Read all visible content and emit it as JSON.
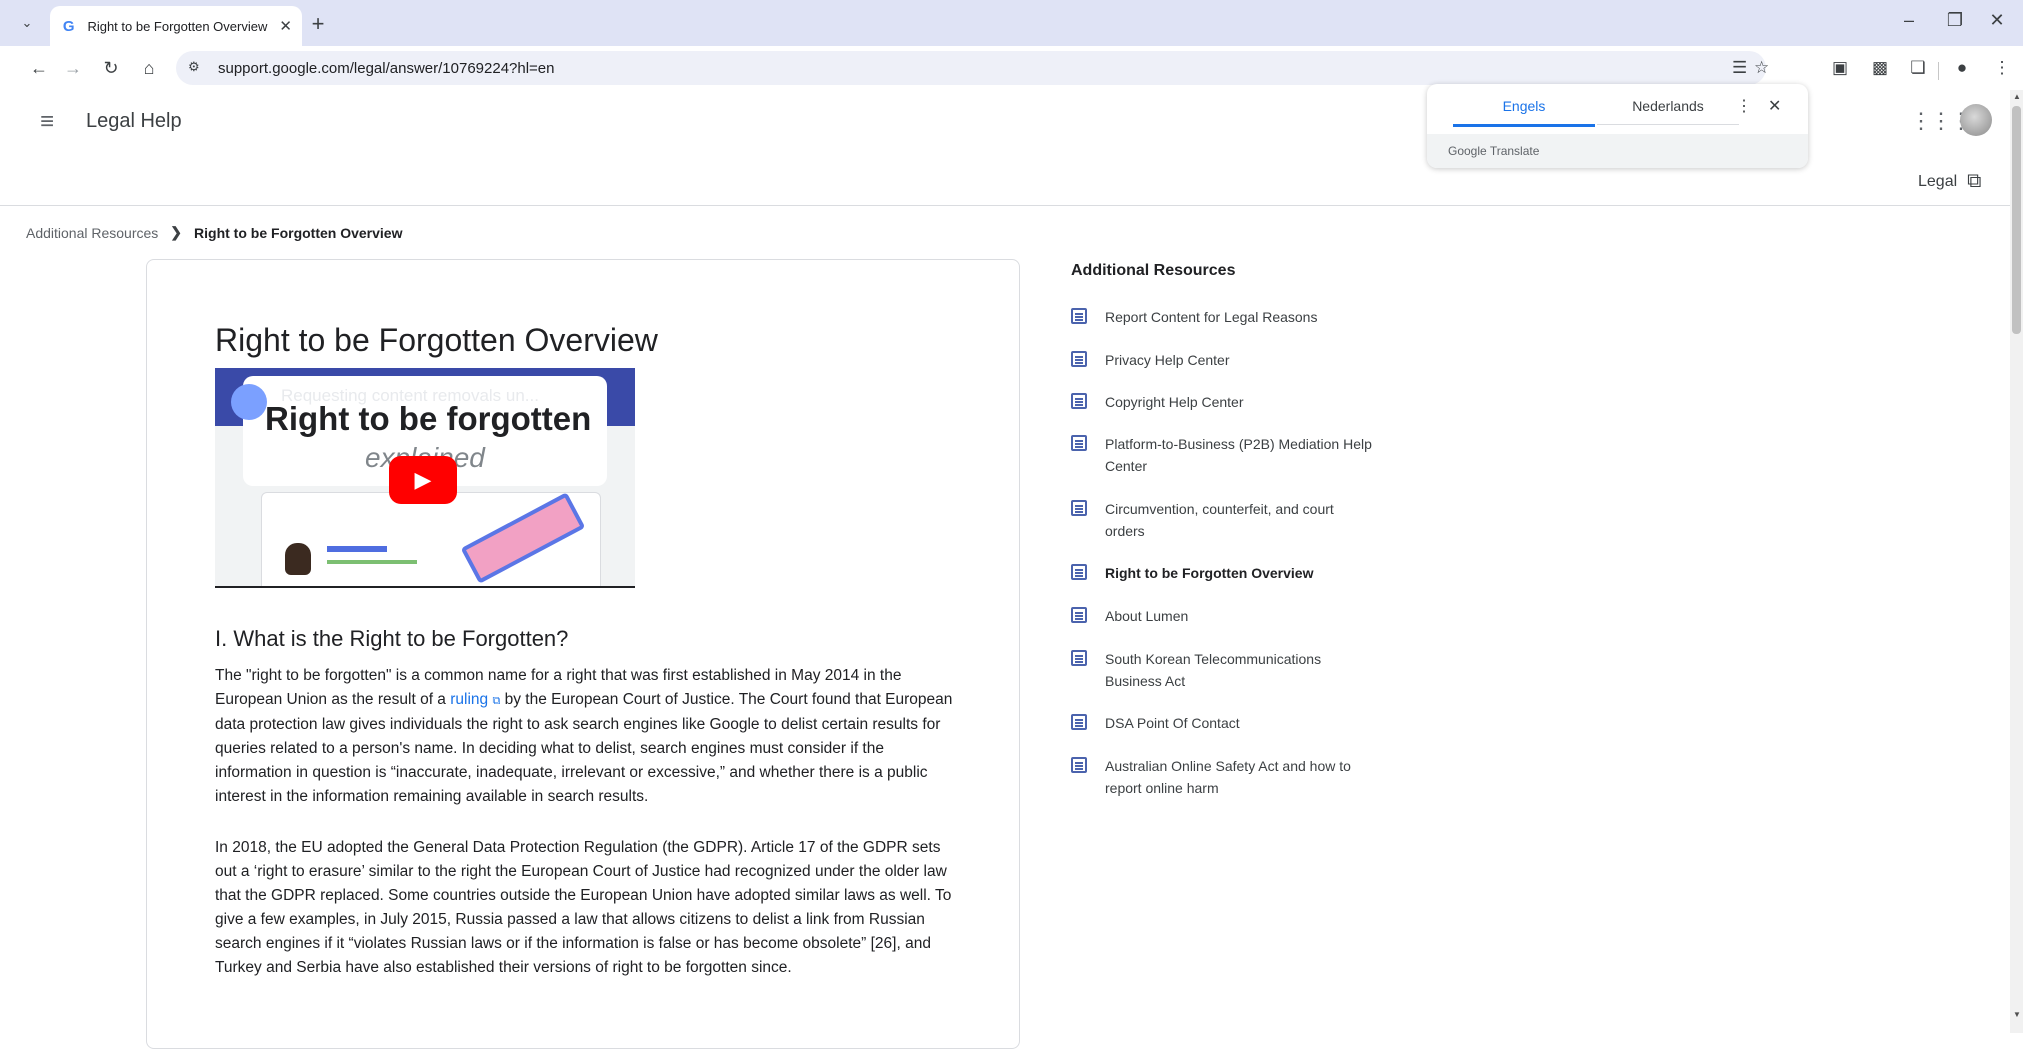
{
  "browser": {
    "tab_title": "Right to be Forgotten Overview",
    "tab_favicon": "G",
    "url": "support.google.com/legal/answer/10769224?hl=en"
  },
  "header": {
    "site_name": "Legal Help",
    "legal_link": "Legal"
  },
  "translate": {
    "active_lang": "Engels",
    "inactive_lang": "Nederlands",
    "brand": "Google Translate"
  },
  "breadcrumb": {
    "parent": "Additional Resources",
    "current": "Right to be Forgotten Overview"
  },
  "article": {
    "title": "Right to be Forgotten Overview",
    "video": {
      "caption": "Requesting content removals un...",
      "headline": "Right to be forgotten",
      "subline": "explained"
    },
    "section1_heading": "I. What is the Right to be Forgotten?",
    "para1_before_link": "The \"right to be forgotten\" is a common name for a right that was first established in May 2014 in the European Union as the result of a ",
    "para1_link": "ruling",
    "para1_after_link": " by the European Court of Justice. The Court found that European data protection law gives individuals the right to ask search engines like Google to delist certain results for queries related to a person's name. In deciding what to delist, search engines must consider if the information in question is “inaccurate, inadequate, irrelevant or excessive,” and whether there is a public interest in the information remaining available in search results.",
    "para2": "In 2018, the EU adopted the General Data Protection Regulation (the GDPR). Article 17 of the GDPR sets out a ‘right to erasure’ similar to the right the European Court of Justice had recognized under the older law that the GDPR replaced. Some countries outside the European Union have adopted similar laws as well. To give a few examples, in July 2015, Russia passed a law that allows citizens to delist a link from Russian search engines if it “violates Russian laws or if the information is false or has become obsolete” [26], and Turkey and Serbia have also established their versions of right to be forgotten since."
  },
  "sidebar": {
    "title": "Additional Resources",
    "items": [
      {
        "label": "Report Content for Legal Reasons"
      },
      {
        "label": "Privacy Help Center"
      },
      {
        "label": "Copyright Help Center"
      },
      {
        "label": "Platform-to-Business (P2B) Mediation Help Center"
      },
      {
        "label": "Circumvention, counterfeit, and court orders"
      },
      {
        "label": "Right to be Forgotten Overview"
      },
      {
        "label": "About Lumen"
      },
      {
        "label": "South Korean Telecommunications Business Act"
      },
      {
        "label": "DSA Point Of Contact"
      },
      {
        "label": "Australian Online Safety Act and how to report online harm"
      }
    ]
  },
  "colors": {
    "accent": "#1a73e8",
    "tabstrip": "#dfe3f5"
  }
}
